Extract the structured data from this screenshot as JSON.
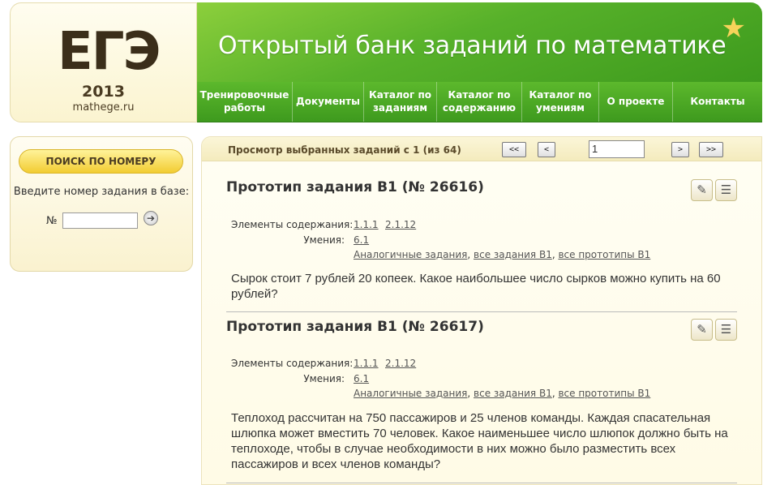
{
  "logo": {
    "title": "ЕГЭ",
    "year": "2013",
    "site": "mathege.ru"
  },
  "banner": {
    "title": "Открытый банк заданий по математике",
    "star_icon": "star-icon"
  },
  "nav": [
    {
      "label": "Тренировочные работы"
    },
    {
      "label": "Документы"
    },
    {
      "label": "Каталог по заданиям"
    },
    {
      "label": "Каталог по содержанию"
    },
    {
      "label": "Каталог по умениям"
    },
    {
      "label": "О проекте"
    },
    {
      "label": "Контакты"
    }
  ],
  "sidebar": {
    "search_button": "ПОИСК ПО НОМЕРУ",
    "label": "Введите номер задания в базе:",
    "num_label": "№",
    "input_value": ""
  },
  "pager": {
    "text": "Просмотр выбранных заданий с 1 (из 64)",
    "first": "<<",
    "prev": "<",
    "page_value": "1",
    "next": ">",
    "last": ">>"
  },
  "tasks": [
    {
      "title": "Прототип задания B1 (№ 26616)",
      "elements_label": "Элементы содержания:",
      "elements": [
        "1.1.1",
        "2.1.12"
      ],
      "skills_label": "Умения:",
      "skills": [
        "6.1"
      ],
      "links": [
        "Аналогичные задания",
        "все задания B1",
        "все прототипы B1"
      ],
      "text": "Сырок стоит 7 рублей 20 копеек. Какое наибольшее число сырков можно купить на 60 рублей?"
    },
    {
      "title": "Прототип задания B1 (№ 26617)",
      "elements_label": "Элементы содержания:",
      "elements": [
        "1.1.1",
        "2.1.12"
      ],
      "skills_label": "Умения:",
      "skills": [
        "6.1"
      ],
      "links": [
        "Аналогичные задания",
        "все задания B1",
        "все прототипы B1"
      ],
      "text": "Теплоход рассчитан на 750 пассажиров и 25 членов команды. Каждая спасательная шлюпка может вместить 70 человек. Какое наименьшее число шлюпок должно быть на теплоходе, чтобы в случае необходимости в них можно было разместить всех пассажиров и всех членов команды?"
    }
  ]
}
